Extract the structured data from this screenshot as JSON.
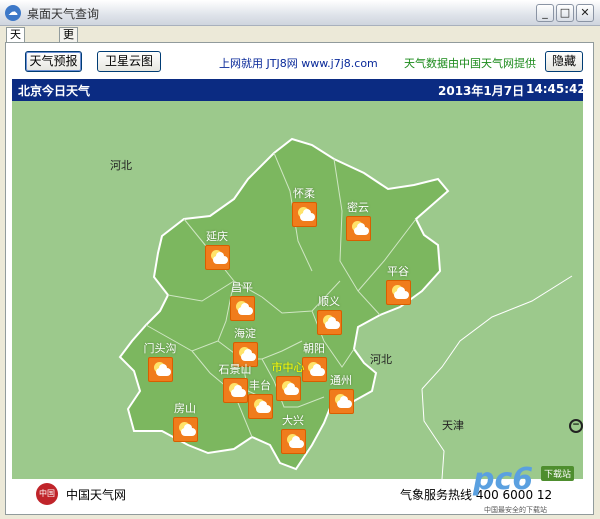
{
  "window": {
    "title": "桌面天气查询"
  },
  "tabs": [
    {
      "label": "天气查询"
    },
    {
      "label": "更新说明"
    }
  ],
  "toolbar": {
    "forecast_button": "天气预报",
    "satellite_button": "卫星云图",
    "site_text": "上网就用 JTJ8网 www.j7j8.com",
    "source_text": "天气数据由中国天气网提供",
    "hide_button": "隐藏"
  },
  "header": {
    "title": "北京今日天气",
    "date": "2013年1月7日",
    "time": "14:45:42"
  },
  "map": {
    "regions": {
      "hebei_left": "河北",
      "hebei_right": "河北",
      "tianjin": "天津"
    },
    "districts": [
      {
        "name": "怀柔",
        "weather_icon": "partly-cloudy-icon"
      },
      {
        "name": "密云",
        "weather_icon": "partly-cloudy-icon"
      },
      {
        "name": "延庆",
        "weather_icon": "partly-cloudy-icon"
      },
      {
        "name": "平谷",
        "weather_icon": "partly-cloudy-icon"
      },
      {
        "name": "昌平",
        "weather_icon": "partly-cloudy-icon"
      },
      {
        "name": "顺义",
        "weather_icon": "partly-cloudy-icon"
      },
      {
        "name": "海淀",
        "weather_icon": "partly-cloudy-icon"
      },
      {
        "name": "门头沟",
        "weather_icon": "partly-cloudy-icon"
      },
      {
        "name": "朝阳",
        "weather_icon": "partly-cloudy-icon"
      },
      {
        "name": "石景山",
        "weather_icon": "partly-cloudy-icon"
      },
      {
        "name": "市中心",
        "weather_icon": "partly-cloudy-icon"
      },
      {
        "name": "丰台",
        "weather_icon": "partly-cloudy-icon"
      },
      {
        "name": "通州",
        "weather_icon": "partly-cloudy-icon"
      },
      {
        "name": "房山",
        "weather_icon": "partly-cloudy-icon"
      },
      {
        "name": "大兴",
        "weather_icon": "partly-cloudy-icon"
      }
    ]
  },
  "footer": {
    "logo_text": "中国",
    "brand": "中国天气网",
    "hotline": "气象服务热线 400 6000 12"
  },
  "watermark": {
    "main": "pc6",
    "sub": "下载站",
    "caption": "中国最安全的下载站"
  },
  "colors": {
    "header_bg": "#0b2b82",
    "map_bg": "#9cc98c",
    "beijing_fill": "#7cb75f",
    "icon_orange": "#f07c1c"
  }
}
